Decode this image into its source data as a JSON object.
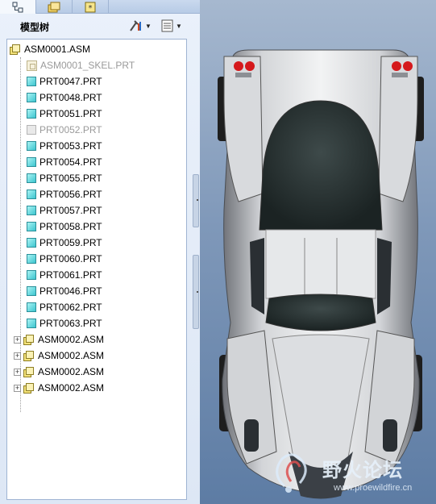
{
  "panel": {
    "title": "模型树"
  },
  "tree": {
    "root": "ASM0001.ASM",
    "items": [
      {
        "label": "ASM0001_SKEL.PRT",
        "kind": "skeleton",
        "suppressed": true
      },
      {
        "label": "PRT0047.PRT",
        "kind": "part"
      },
      {
        "label": "PRT0048.PRT",
        "kind": "part"
      },
      {
        "label": "PRT0051.PRT",
        "kind": "part"
      },
      {
        "label": "PRT0052.PRT",
        "kind": "part",
        "suppressed": true
      },
      {
        "label": "PRT0053.PRT",
        "kind": "part"
      },
      {
        "label": "PRT0054.PRT",
        "kind": "part"
      },
      {
        "label": "PRT0055.PRT",
        "kind": "part"
      },
      {
        "label": "PRT0056.PRT",
        "kind": "part"
      },
      {
        "label": "PRT0057.PRT",
        "kind": "part"
      },
      {
        "label": "PRT0058.PRT",
        "kind": "part"
      },
      {
        "label": "PRT0059.PRT",
        "kind": "part"
      },
      {
        "label": "PRT0060.PRT",
        "kind": "part"
      },
      {
        "label": "PRT0061.PRT",
        "kind": "part"
      },
      {
        "label": "PRT0046.PRT",
        "kind": "part"
      },
      {
        "label": "PRT0062.PRT",
        "kind": "part"
      },
      {
        "label": "PRT0063.PRT",
        "kind": "part"
      },
      {
        "label": "ASM0002.ASM",
        "kind": "assembly"
      },
      {
        "label": "ASM0002.ASM",
        "kind": "assembly"
      },
      {
        "label": "ASM0002.ASM",
        "kind": "assembly"
      },
      {
        "label": "ASM0002.ASM",
        "kind": "assembly"
      }
    ]
  },
  "watermark": {
    "title": "野火论坛",
    "url": "www.proewildfire.cn"
  },
  "colors": {
    "part_icon": "#3cc5cf",
    "assembly_icon": "#f3e27a",
    "suppressed_text": "#9a9a9a",
    "viewport_bg": "#7f98b9"
  }
}
